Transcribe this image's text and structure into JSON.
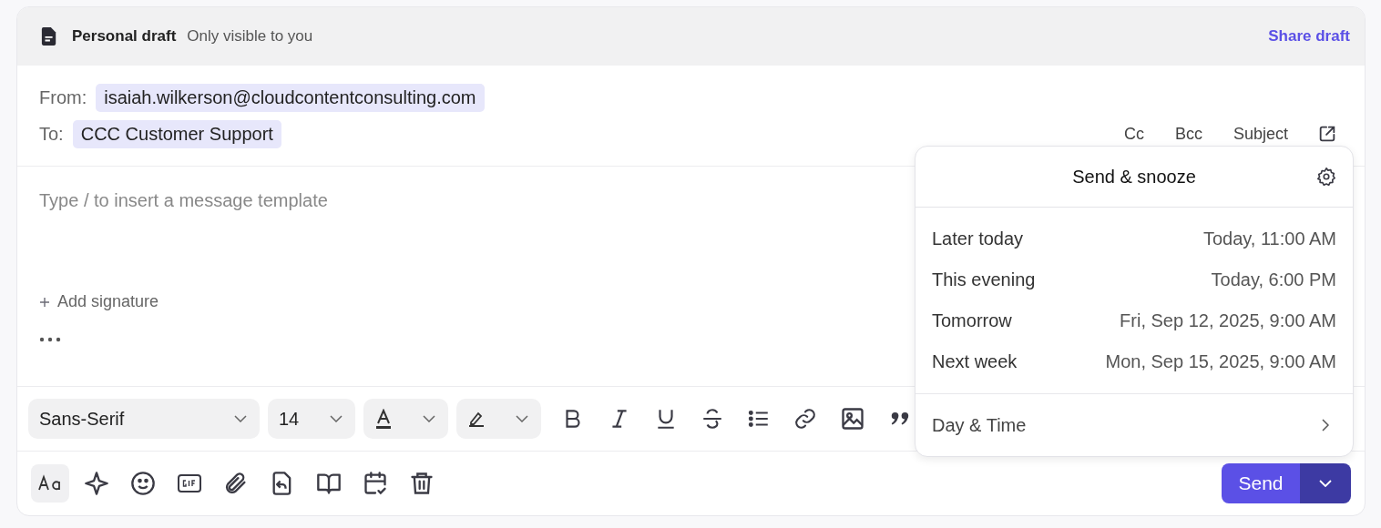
{
  "header": {
    "title": "Personal draft",
    "subtitle": "Only visible to you",
    "share": "Share draft"
  },
  "from": {
    "label": "From:",
    "value": "isaiah.wilkerson@cloudcontentconsulting.com"
  },
  "to": {
    "label": "To:",
    "value": "CCC Customer Support"
  },
  "field_links": [
    "Cc",
    "Bcc",
    "Subject"
  ],
  "body": {
    "placeholder": "Type / to insert a message template",
    "add_signature": "Add signature"
  },
  "format_toolbar": {
    "font": "Sans-Serif",
    "size": "14",
    "tools": [
      {
        "kind": "bold"
      },
      {
        "kind": "italic"
      },
      {
        "kind": "underline"
      },
      {
        "kind": "strike"
      },
      {
        "kind": "bullets"
      },
      {
        "kind": "link"
      },
      {
        "kind": "image"
      },
      {
        "kind": "quote"
      }
    ]
  },
  "actions": [
    {
      "kind": "format",
      "selected": true
    },
    {
      "kind": "sparkle",
      "selected": false
    },
    {
      "kind": "emoji",
      "selected": false
    },
    {
      "kind": "gif",
      "selected": false
    },
    {
      "kind": "attach",
      "selected": false
    },
    {
      "kind": "reply",
      "selected": false
    },
    {
      "kind": "book",
      "selected": false
    },
    {
      "kind": "calendar",
      "selected": false
    },
    {
      "kind": "trash",
      "selected": false
    }
  ],
  "send_button": "Send",
  "snooze_menu": {
    "title": "Send & snooze",
    "options": [
      {
        "label": "Later today",
        "time": "Today, 11:00 AM"
      },
      {
        "label": "This evening",
        "time": "Today, 6:00 PM"
      },
      {
        "label": "Tomorrow",
        "time": "Fri, Sep 12, 2025, 9:00 AM"
      },
      {
        "label": "Next week",
        "time": "Mon, Sep 15, 2025, 9:00 AM"
      }
    ],
    "custom": "Day & Time"
  }
}
